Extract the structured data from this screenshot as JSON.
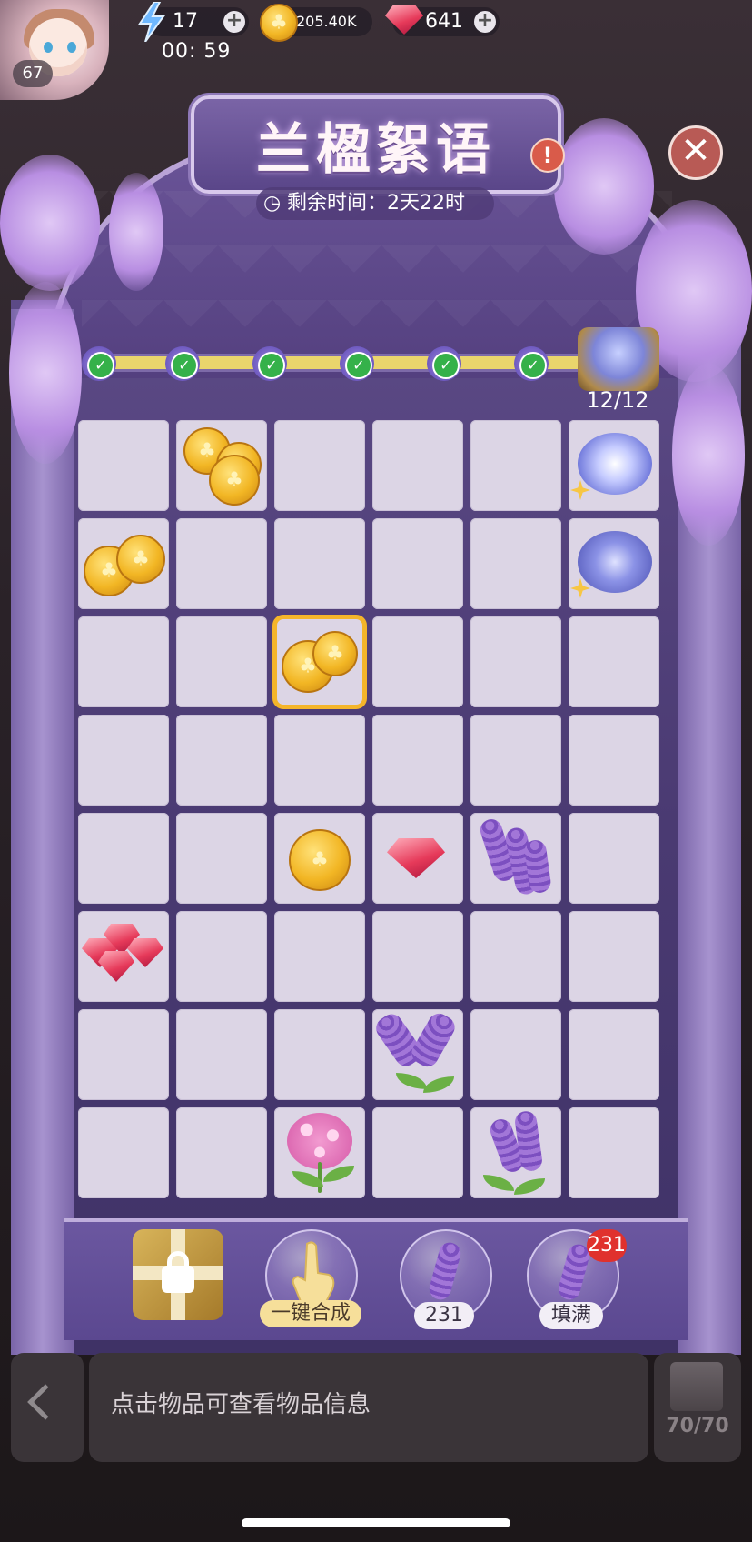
{
  "hud": {
    "level": "67",
    "energy": "17",
    "energy_timer": "00: 59",
    "coins": "205.40K",
    "gems": "641"
  },
  "event": {
    "title": "兰楹絮语",
    "remaining_label": "剩余时间：2天22时",
    "progress_text": "12/12"
  },
  "board": {
    "rows": 8,
    "cols": 6
  },
  "buttons": {
    "auto_merge_label": "一键合成",
    "lavender_count": "231",
    "fill_label": "填满",
    "fill_badge": "231"
  },
  "info_bar": {
    "hint": "点击物品可查看物品信息",
    "storage": "70/70"
  },
  "colors": {
    "frame": "#4a3a72",
    "cell": "#dcd5e5",
    "selection": "#f4b52a",
    "progress": "#ead56c",
    "check": "#35b14a"
  }
}
